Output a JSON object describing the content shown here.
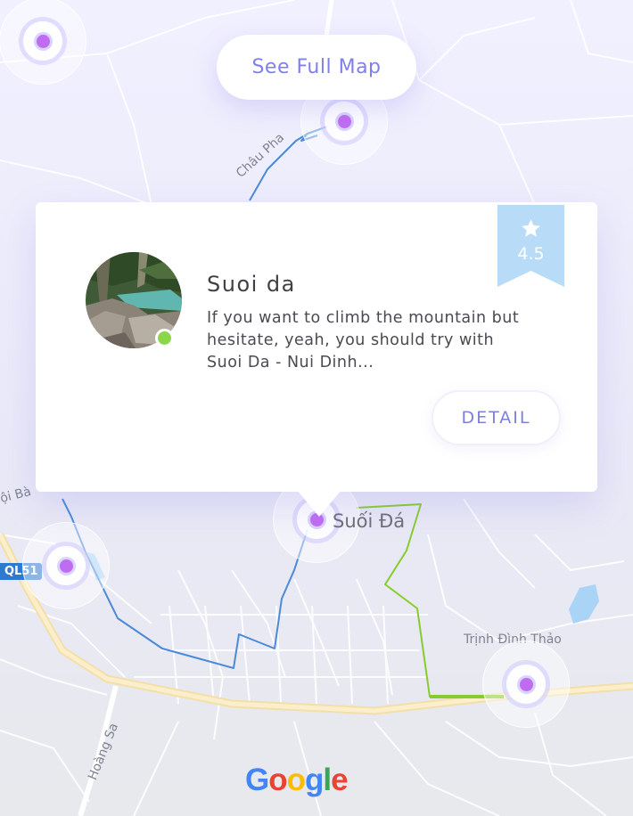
{
  "map": {
    "place_label": "Suối Đá",
    "road_labels": {
      "chau_pha": "Châu Pha",
      "trinh_dinh_thao": "Trịnh Đình Thảo",
      "hoang_sa": "Hoàng Sa",
      "doi_ba": "ội Bà"
    },
    "highway_shield": "QL51",
    "attribution": [
      "G",
      "o",
      "o",
      "g",
      "l",
      "e"
    ],
    "attribution_colors": [
      "#4285F4",
      "#EA4335",
      "#FBBC05",
      "#4285F4",
      "#34A853",
      "#EA4335"
    ],
    "marker_color": "#c06cf0",
    "route_colors": {
      "primary": "#4a8ad9",
      "secondary": "#86cc2e"
    }
  },
  "buttons": {
    "see_full_map": "See Full Map",
    "detail": "DETAIL"
  },
  "card": {
    "title": "Suoi da",
    "description": "If you want to climb the mountain but hesitate, yeah, you should try with Suoi Da - Nui Dinh...",
    "rating": "4.5",
    "status": "online",
    "status_color": "#8cd64a",
    "rating_badge_color": "#b8dcf7",
    "accent_color": "#7f7fee"
  }
}
